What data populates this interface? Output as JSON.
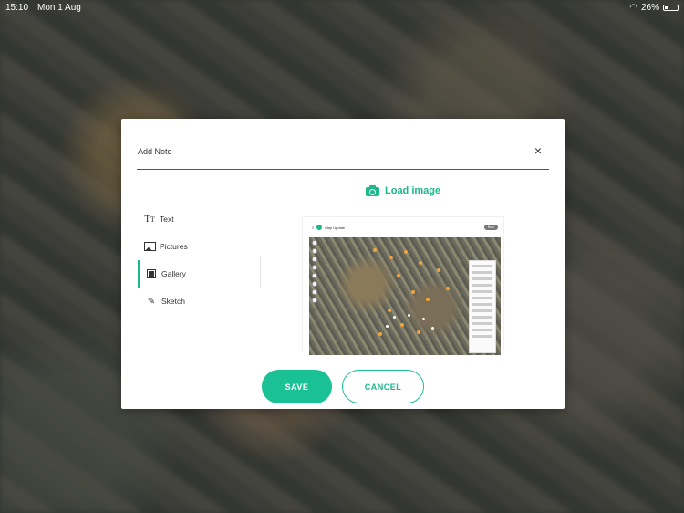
{
  "status_bar": {
    "time": "15:10",
    "date": "Mon 1 Aug",
    "battery": "26%"
  },
  "modal": {
    "title": "Add Note",
    "close_glyph": "×",
    "load_image_label": "Load image",
    "menu": [
      {
        "label": "Text",
        "icon": "text-icon",
        "active": false
      },
      {
        "label": "Pictures",
        "icon": "pictures-icon",
        "active": false
      },
      {
        "label": "Gallery",
        "icon": "gallery-icon",
        "active": true
      },
      {
        "label": "Sketch",
        "icon": "sketch-icon",
        "active": false
      }
    ],
    "preview": {
      "app_title": "Map Update",
      "pill_label": "Nutz"
    },
    "save_label": "SAVE",
    "cancel_label": "CANCEL"
  },
  "colors": {
    "accent": "#19c195",
    "accent_text": "#19b98a",
    "active_bar": "#19b98a"
  }
}
